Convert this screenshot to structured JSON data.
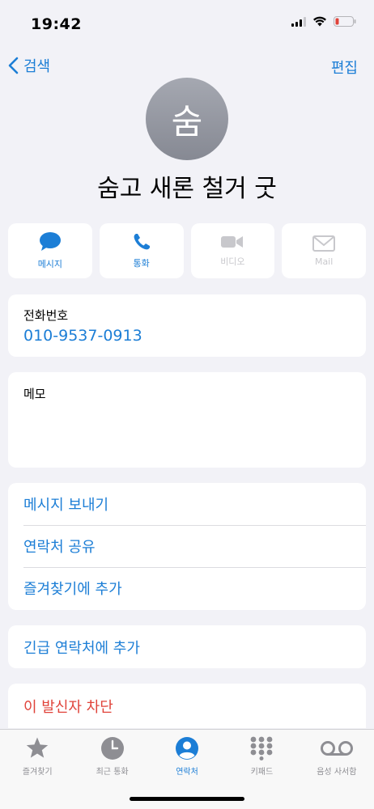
{
  "status_bar": {
    "time": "19:42"
  },
  "nav": {
    "back_label": "검색",
    "edit_label": "편집"
  },
  "contact": {
    "avatar_initial": "숨",
    "name": "숨고 새론 철거 굿"
  },
  "actions": [
    {
      "label": "메시지",
      "icon": "message-bubble-icon",
      "enabled": true
    },
    {
      "label": "통화",
      "icon": "phone-icon",
      "enabled": true
    },
    {
      "label": "비디오",
      "icon": "video-camera-icon",
      "enabled": false
    },
    {
      "label": "Mail",
      "icon": "envelope-icon",
      "enabled": false
    }
  ],
  "phone": {
    "label": "전화번호",
    "number": "010-9537-0913"
  },
  "memo": {
    "label": "메모"
  },
  "options": [
    {
      "label": "메시지 보내기"
    },
    {
      "label": "연락처 공유"
    },
    {
      "label": "즐겨찾기에 추가"
    }
  ],
  "emergency": {
    "label": "긴급 연락처에 추가"
  },
  "block": {
    "label": "이 발신자 차단"
  },
  "tabs": [
    {
      "label": "즐겨찾기",
      "icon": "star-icon",
      "active": false
    },
    {
      "label": "최근 통화",
      "icon": "clock-icon",
      "active": false
    },
    {
      "label": "연락처",
      "icon": "person-circle-icon",
      "active": true
    },
    {
      "label": "키패드",
      "icon": "keypad-icon",
      "active": false
    },
    {
      "label": "음성 사서함",
      "icon": "voicemail-icon",
      "active": false
    }
  ],
  "colors": {
    "accent": "#1c7ed6",
    "destructive": "#e0433a",
    "disabled": "#c8c8cc",
    "background": "#f2f2f7"
  }
}
